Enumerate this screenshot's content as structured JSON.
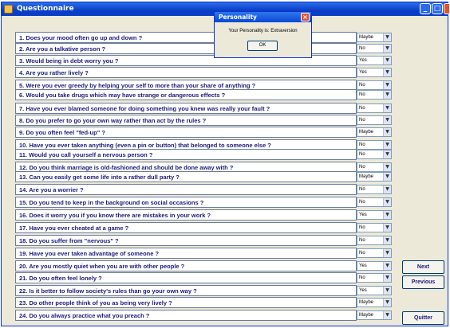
{
  "window": {
    "title": "Questionnaire"
  },
  "questions": [
    {
      "text": "1. Does your mood often go up and down ?",
      "answer": "Maybe"
    },
    {
      "text": "2. Are you a talkative person ?",
      "answer": "No"
    },
    {
      "text": "3. Would being in debt worry you ?",
      "answer": "Yes"
    },
    {
      "text": "4. Are you rather lively ?",
      "answer": "Yes"
    },
    {
      "text": "5. Were you ever greedy by helping your self to more than    your share of anything ?",
      "answer": "No"
    },
    {
      "text": "6. Would you take drugs which may have strange or dangerous effects ?",
      "answer": "No"
    },
    {
      "text": "7. Have you ever blamed someone for doing something you knew was really your fault ?",
      "answer": "No"
    },
    {
      "text": "8. Do you prefer to go your own way rather than act by the rules ?",
      "answer": "No"
    },
    {
      "text": "9. Do you often feel \"fed-up\" ?",
      "answer": "Maybe"
    },
    {
      "text": "10. Have you ever taken anything (even a pin or button) that belonged to someone else ?",
      "answer": "No"
    },
    {
      "text": "11. Would you call yourself a nervous person ?",
      "answer": "No"
    },
    {
      "text": "12. Do you think marriage is old-fashioned and should be done away with ?",
      "answer": "No"
    },
    {
      "text": "13. Can you easily get some life into a rather dull party ?",
      "answer": "Maybe"
    },
    {
      "text": "14. Are you a worrier ?",
      "answer": "No"
    },
    {
      "text": "15. Do you tend to keep in the background on social occasions ?",
      "answer": "No"
    },
    {
      "text": "16. Does it worry you if you know there are mistakes in your work ?",
      "answer": "Yes"
    },
    {
      "text": "17. Have you ever cheated at a game ?",
      "answer": "No"
    },
    {
      "text": "18. Do you suffer from \"nervous\" ?",
      "answer": "No"
    },
    {
      "text": "19. Have you ever taken advantage of someone ?",
      "answer": "No"
    },
    {
      "text": "20. Are you mostly quiet when you are with other people ?",
      "answer": "Yes"
    },
    {
      "text": "21. Do you often feel lonely ?",
      "answer": "No"
    },
    {
      "text": "22. Is it better to follow society's rules than go your own way ?",
      "answer": "Yes"
    },
    {
      "text": "23. Do other people think of you as being very lively ?",
      "answer": "Maybe"
    },
    {
      "text": "24. Do you always practice what you preach ?",
      "answer": "Maybe"
    }
  ],
  "buttons": {
    "next": "Next",
    "previous": "Previous",
    "quit": "Quitter"
  },
  "dialog": {
    "title": "Personality",
    "message": "Your Personality is: Extraversion",
    "ok": "OK"
  },
  "colors": {
    "titlebar": "#0a3ec6",
    "accent_text": "#1a1a7a",
    "close": "#e2512f"
  }
}
